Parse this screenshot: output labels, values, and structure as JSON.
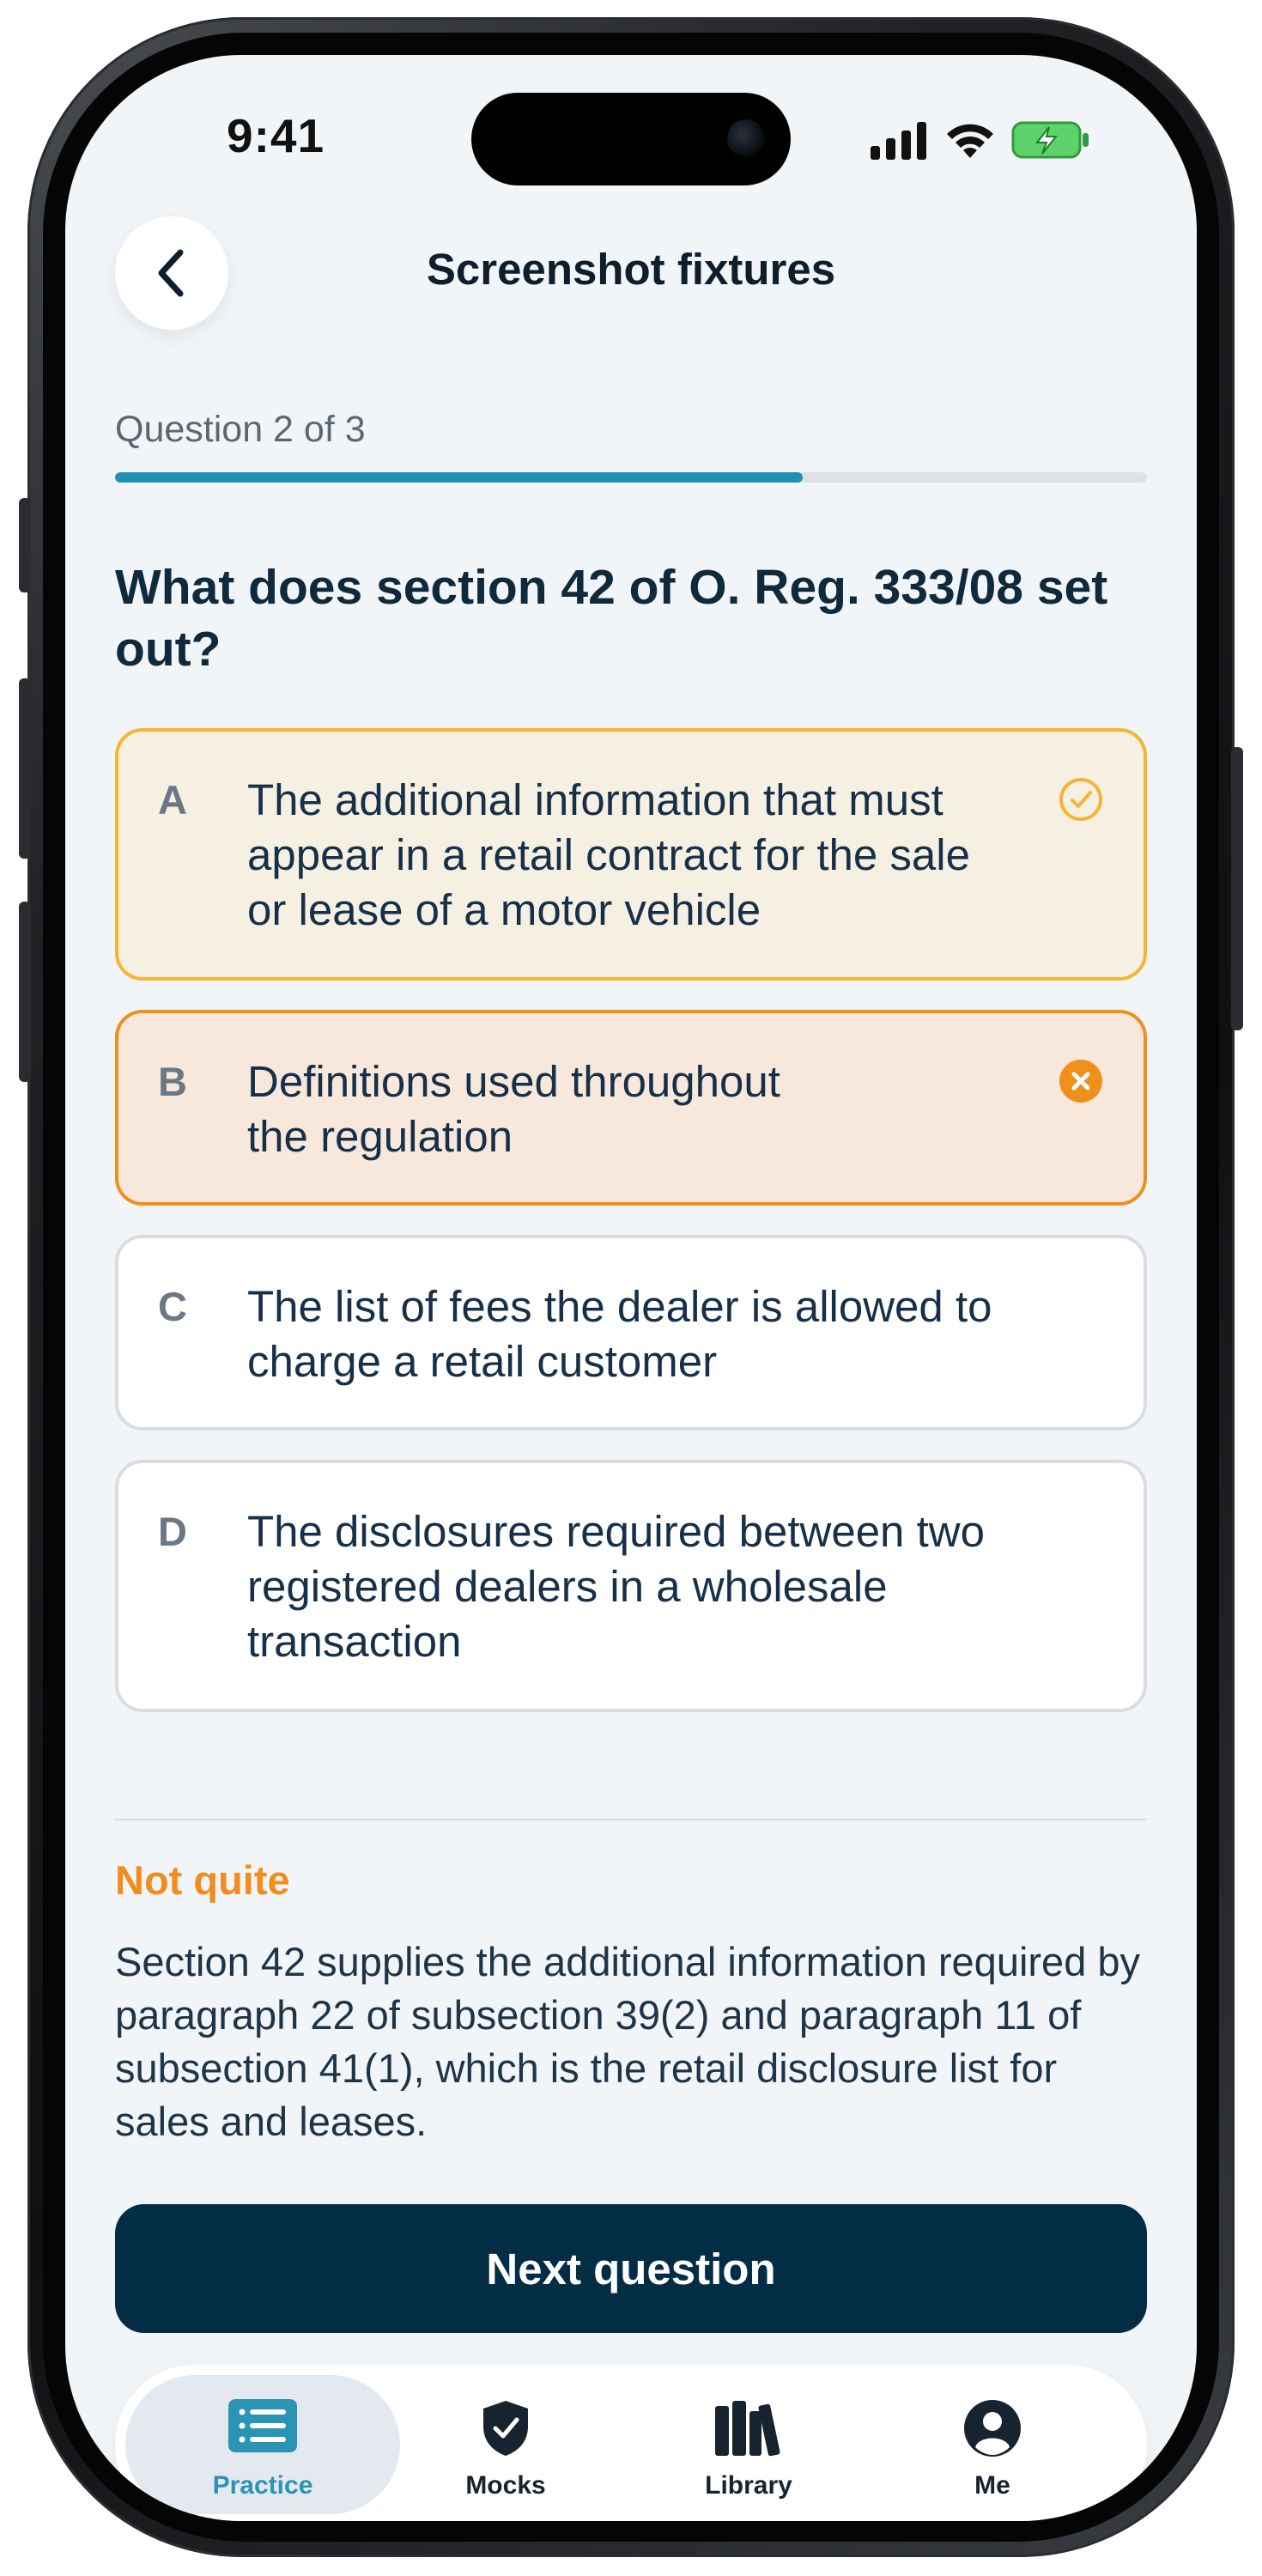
{
  "status_bar": {
    "time": "9:41"
  },
  "header": {
    "title": "Screenshot fixtures"
  },
  "progress": {
    "label": "Question 2 of 3",
    "current": 2,
    "total": 3,
    "fraction": 0.6667
  },
  "question": {
    "text": "What does section 42 of O. Reg. 333/08 set out?"
  },
  "options": [
    {
      "letter": "A",
      "text": "The additional information that must appear in a retail contract for the sale or lease of a motor vehicle",
      "state": "correct",
      "icon": "check-circle-icon"
    },
    {
      "letter": "B",
      "text": "Definitions used throughout the regulation",
      "state": "incorrect-selected",
      "icon": "x-circle-icon"
    },
    {
      "letter": "C",
      "text": "The list of fees the dealer is allowed to charge a retail customer",
      "state": "neutral",
      "icon": ""
    },
    {
      "letter": "D",
      "text": "The disclosures required between two registered dealers in a wholesale transaction",
      "state": "neutral",
      "icon": ""
    }
  ],
  "feedback": {
    "verdict": "Not quite",
    "explanation": "Section 42 supplies the additional information required by paragraph 22 of subsection 39(2) and paragraph 11 of subsection 41(1), which is the retail disclosure list for sales and leases."
  },
  "actions": {
    "next_label": "Next question"
  },
  "tabs": [
    {
      "label": "Practice",
      "icon": "list-icon",
      "active": true
    },
    {
      "label": "Mocks",
      "icon": "shield-check-icon",
      "active": false
    },
    {
      "label": "Library",
      "icon": "books-icon",
      "active": false
    },
    {
      "label": "Me",
      "icon": "person-circle-icon",
      "active": false
    }
  ],
  "colors": {
    "accent": "#1f8fb2",
    "correct_border": "#f5b532",
    "wrong_border": "#ef8f1c",
    "verdict": "#f18d1e",
    "primary_button": "#032d44"
  }
}
